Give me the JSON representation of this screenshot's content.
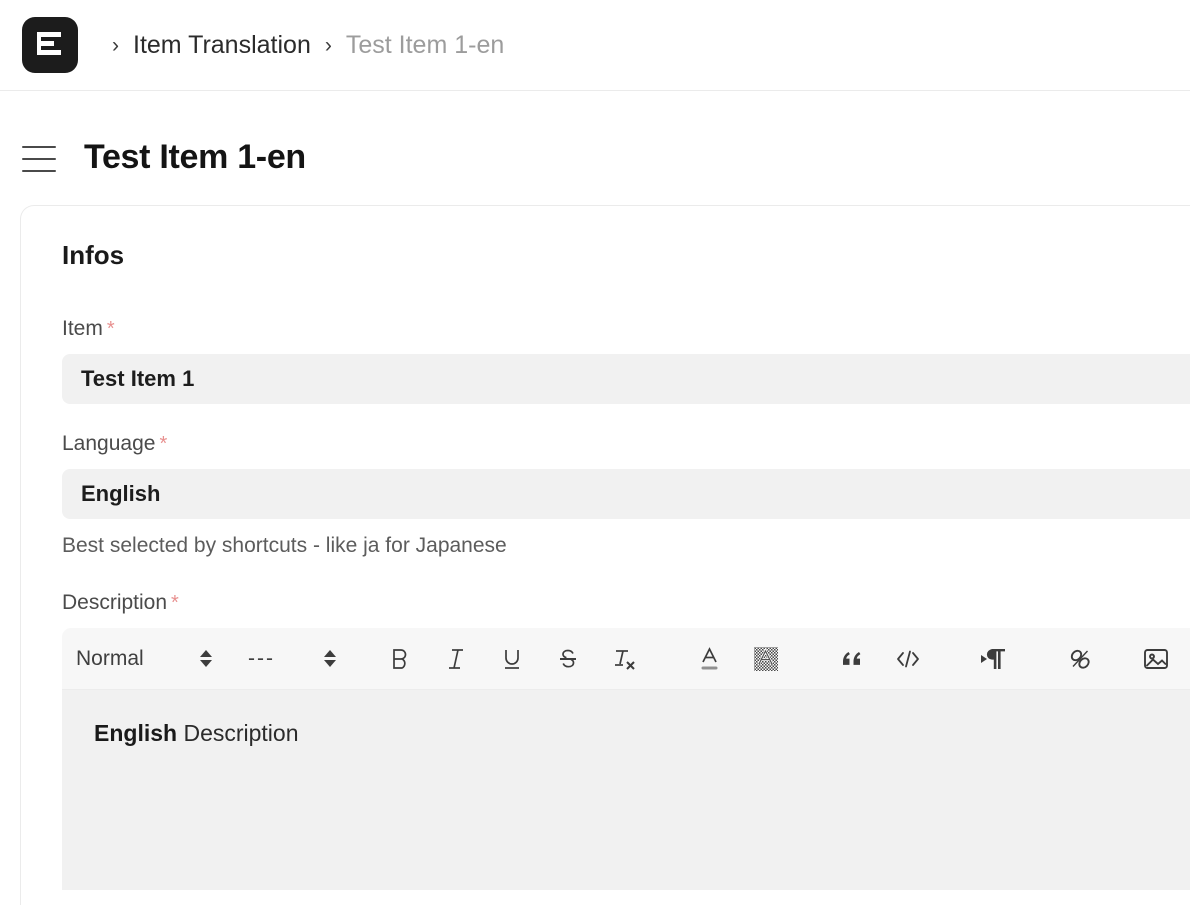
{
  "brand": {
    "logo_icon": "evershop-e-logo",
    "logo_bg": "#1c1c1c"
  },
  "breadcrumb": {
    "separator": "›",
    "items": [
      {
        "label": "Item Translation",
        "current": false
      },
      {
        "label": "Test Item 1-en",
        "current": true
      }
    ]
  },
  "page": {
    "menu_icon": "hamburger-menu-icon",
    "title": "Test Item 1-en"
  },
  "card": {
    "title": "Infos",
    "fields": {
      "item": {
        "label": "Item",
        "required_marker": "*",
        "value": "Test Item 1"
      },
      "language": {
        "label": "Language",
        "required_marker": "*",
        "value": "English",
        "hint": "Best selected by shortcuts - like ja for Japanese"
      },
      "description": {
        "label": "Description",
        "required_marker": "*",
        "content_bold": "English",
        "content_rest": " Description"
      }
    }
  },
  "editor": {
    "format_select": {
      "value": "Normal",
      "icon": "chevron-updown-icon"
    },
    "size_select": {
      "value": "---",
      "icon": "chevron-updown-icon"
    },
    "buttons": [
      {
        "name": "bold-icon",
        "title": "Bold"
      },
      {
        "name": "italic-icon",
        "title": "Italic"
      },
      {
        "name": "underline-icon",
        "title": "Underline"
      },
      {
        "name": "strikethrough-icon",
        "title": "Strikethrough"
      },
      {
        "name": "clear-format-icon",
        "title": "Clear formatting"
      },
      {
        "name": "text-color-icon",
        "title": "Text color"
      },
      {
        "name": "highlight-color-icon",
        "title": "Background color"
      },
      {
        "name": "blockquote-icon",
        "title": "Blockquote"
      },
      {
        "name": "code-block-icon",
        "title": "Code block"
      },
      {
        "name": "text-direction-icon",
        "title": "Text direction"
      },
      {
        "name": "link-icon",
        "title": "Insert link"
      },
      {
        "name": "image-icon",
        "title": "Insert image"
      }
    ]
  },
  "colors": {
    "accent_required": "#e8908f",
    "input_bg": "#f1f1f1",
    "toolbar_bg": "#f7f7f7",
    "border": "#ebebeb"
  }
}
